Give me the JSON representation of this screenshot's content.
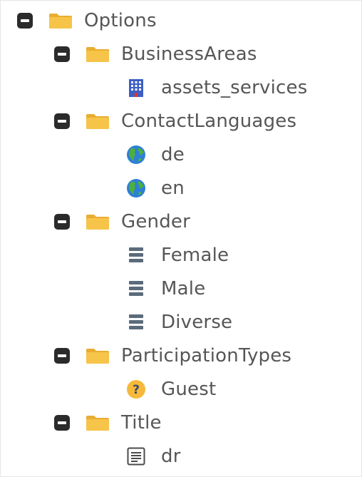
{
  "tree": {
    "root": {
      "label": "Options",
      "icon": "folder-icon",
      "expanded": true,
      "children": [
        {
          "label": "BusinessAreas",
          "icon": "folder-icon",
          "expanded": true,
          "items": [
            {
              "label": "assets_services",
              "icon": "building-icon"
            }
          ]
        },
        {
          "label": "ContactLanguages",
          "icon": "folder-icon",
          "expanded": true,
          "items": [
            {
              "label": "de",
              "icon": "globe-icon"
            },
            {
              "label": "en",
              "icon": "globe-icon"
            }
          ]
        },
        {
          "label": "Gender",
          "icon": "folder-icon",
          "expanded": true,
          "items": [
            {
              "label": "Female",
              "icon": "list-icon"
            },
            {
              "label": "Male",
              "icon": "list-icon"
            },
            {
              "label": "Diverse",
              "icon": "list-icon"
            }
          ]
        },
        {
          "label": "ParticipationTypes",
          "icon": "folder-icon",
          "expanded": true,
          "items": [
            {
              "label": "Guest",
              "icon": "question-icon"
            }
          ]
        },
        {
          "label": "Title",
          "icon": "folder-icon",
          "expanded": true,
          "items": [
            {
              "label": "dr",
              "icon": "document-icon"
            }
          ]
        }
      ]
    }
  },
  "colors": {
    "folder": "#f7c44a",
    "folder_dark": "#e9ad2f",
    "toggle": "#2b2b2b",
    "text": "#565656",
    "list_icon": "#5a6b7b",
    "building": "#3d5fc4",
    "globe_water": "#2e7fd6",
    "globe_land": "#4caf3e",
    "question_badge": "#f6b93b"
  }
}
